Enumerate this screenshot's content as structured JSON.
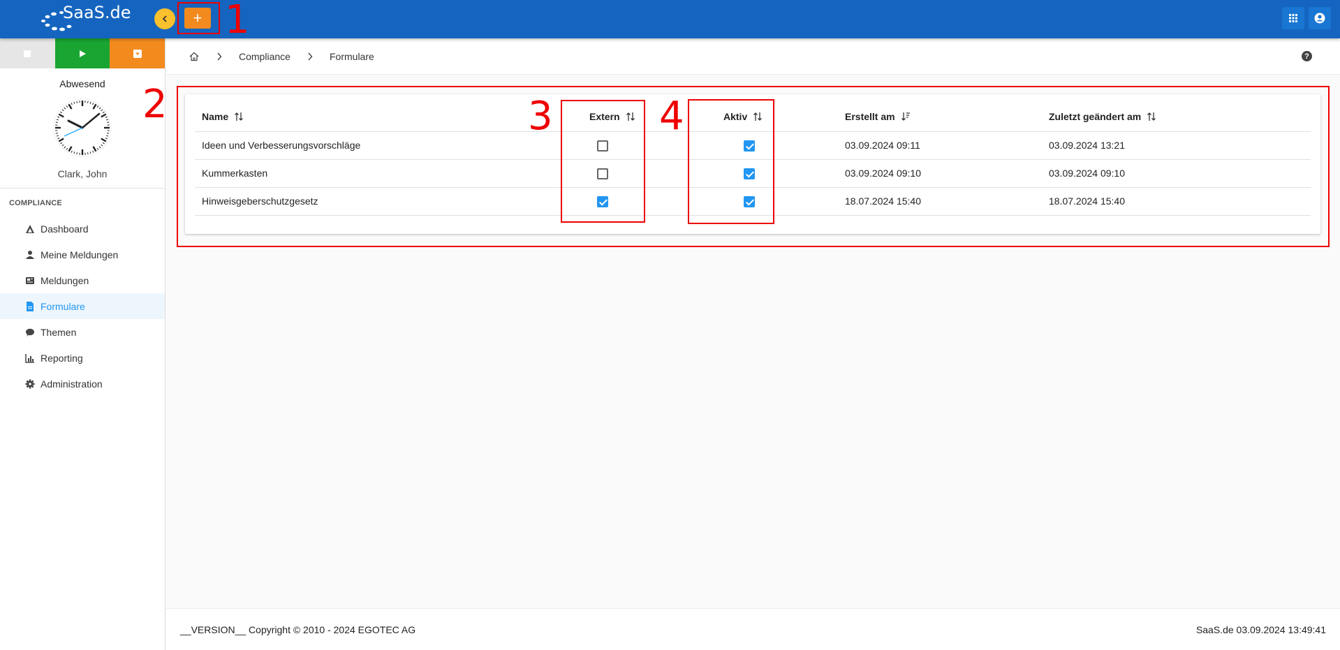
{
  "header": {
    "logo_text": "SaaS.de",
    "add_label": "+"
  },
  "sidebar": {
    "status": "Abwesend",
    "user": "Clark, John",
    "section": "COMPLIANCE",
    "items": [
      {
        "label": "Dashboard",
        "icon": "dashboard-icon"
      },
      {
        "label": "Meine Meldungen",
        "icon": "person-icon"
      },
      {
        "label": "Meldungen",
        "icon": "reports-icon"
      },
      {
        "label": "Formulare",
        "icon": "document-icon",
        "active": true
      },
      {
        "label": "Themen",
        "icon": "chat-icon"
      },
      {
        "label": "Reporting",
        "icon": "chart-icon"
      },
      {
        "label": "Administration",
        "icon": "gear-icon"
      }
    ]
  },
  "breadcrumb": {
    "items": [
      "Compliance",
      "Formulare"
    ]
  },
  "table": {
    "headers": {
      "name": "Name",
      "extern": "Extern",
      "aktiv": "Aktiv",
      "erstellt": "Erstellt am",
      "geaendert": "Zuletzt geändert am"
    },
    "rows": [
      {
        "name": "Ideen und Verbesserungsvorschläge",
        "extern": false,
        "aktiv": true,
        "erstellt": "03.09.2024 09:11",
        "geaendert": "03.09.2024 13:21"
      },
      {
        "name": "Kummerkasten",
        "extern": false,
        "aktiv": true,
        "erstellt": "03.09.2024 09:10",
        "geaendert": "03.09.2024 09:10"
      },
      {
        "name": "Hinweisgeberschutzgesetz",
        "extern": true,
        "aktiv": true,
        "erstellt": "18.07.2024 15:40",
        "geaendert": "18.07.2024 15:40"
      }
    ]
  },
  "annotations": [
    "1",
    "2",
    "3",
    "4"
  ],
  "footer": {
    "left": "__VERSION__ Copyright © 2010 - 2024 EGOTEC AG",
    "right": "SaaS.de  03.09.2024 13:49:41"
  },
  "colors": {
    "topbar": "#1565c0",
    "accent": "#2196f3",
    "orange": "#f28a1e",
    "green": "#1aa533",
    "annotation": "#ee0000"
  }
}
